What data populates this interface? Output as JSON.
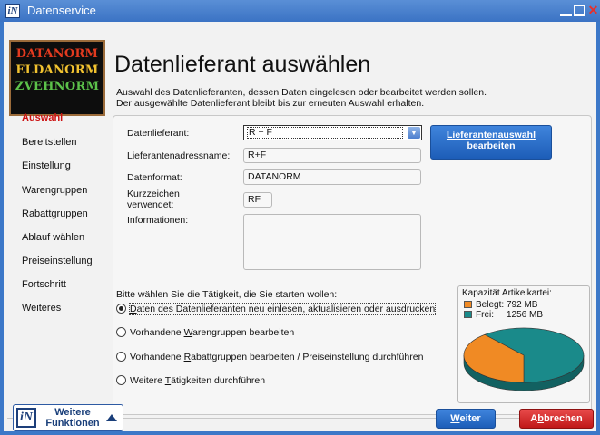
{
  "window": {
    "title": "Datenservice"
  },
  "logo": {
    "lines": [
      "DATANORM",
      "ELDANORM",
      "ZVEHNORM"
    ]
  },
  "sidebar": {
    "items": [
      {
        "label": "Auswahl",
        "active": true
      },
      {
        "label": "Bereitstellen"
      },
      {
        "label": "Einstellung"
      },
      {
        "label": "Warengruppen"
      },
      {
        "label": "Rabattgruppen"
      },
      {
        "label": "Ablauf wählen"
      },
      {
        "label": "Preiseinstellung"
      },
      {
        "label": "Fortschritt"
      },
      {
        "label": "Weiteres"
      }
    ]
  },
  "main": {
    "heading": "Datenlieferant auswählen",
    "description_line1": "Auswahl des Datenlieferanten, dessen Daten eingelesen oder bearbeitet werden sollen.",
    "description_line2": "Der ausgewählte Datenlieferant bleibt bis zur erneuten Auswahl erhalten.",
    "form": {
      "supplier_label": "Datenlieferant:",
      "supplier_value": "R + F",
      "address_name_label": "Lieferantenadressname:",
      "address_name_value": "R+F",
      "format_label": "Datenformat:",
      "format_value": "DATANORM",
      "shortcode_label_1": "Kurzzeichen",
      "shortcode_label_2": "verwendet:",
      "shortcode_value": "RF",
      "info_label": "Informationen:",
      "info_value": ""
    },
    "edit_supplier_button": {
      "line1": "Lieferantenauswahl",
      "line2": "bearbeiten"
    },
    "activity": {
      "prompt": "Bitte wählen Sie die Tätigkeit, die Sie starten wollen:",
      "options": [
        {
          "pre": "",
          "mnemonic": "D",
          "post": "aten des Datenlieferanten neu einlesen, aktualisieren oder ausdrucken",
          "selected": true
        },
        {
          "pre": "Vorhandene ",
          "mnemonic": "W",
          "post": "arengruppen bearbeiten",
          "selected": false
        },
        {
          "pre": "Vorhandene ",
          "mnemonic": "R",
          "post": "abattgruppen bearbeiten / Preiseinstellung durchführen",
          "selected": false
        },
        {
          "pre": "Weitere ",
          "mnemonic": "T",
          "post": "ätigkeiten durchführen",
          "selected": false
        }
      ]
    },
    "capacity": {
      "title": "Kapazität Artikelkartei:",
      "used_label": "Belegt:",
      "used_value": "792 MB",
      "free_label": "Frei:",
      "free_value": "1256 MB",
      "used_mb": 792,
      "free_mb": 1256,
      "colors": {
        "used": "#f08a24",
        "free": "#1a8a8a"
      }
    }
  },
  "footer": {
    "more_functions": {
      "line1": "Weitere",
      "line2": "Funktionen"
    },
    "next_button": {
      "mnemonic": "W",
      "rest": "eiter"
    },
    "cancel_button": {
      "pre": "A",
      "mnemonic": "b",
      "rest": "brechen"
    }
  }
}
